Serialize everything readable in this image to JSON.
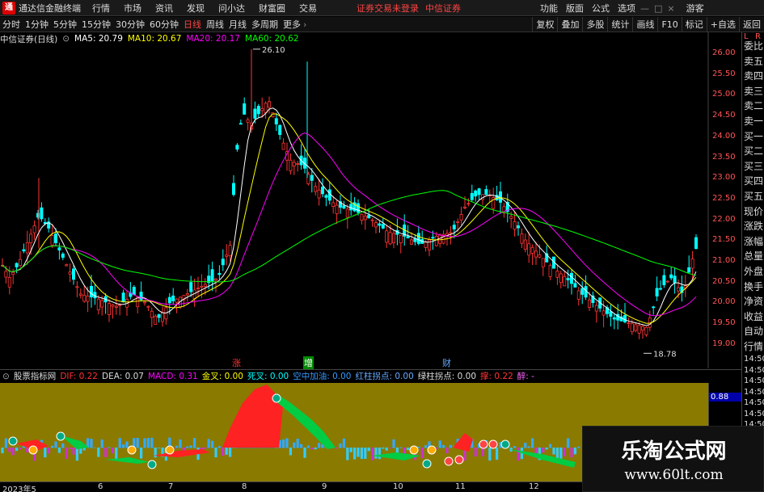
{
  "window": {
    "app_title": "通达信金融终端",
    "menu": [
      "行情",
      "市场",
      "资讯",
      "发现",
      "问小达",
      "财富圈",
      "交易"
    ],
    "notice_login": "证券交易未登录",
    "notice_broker": "中信证券",
    "right_menu": [
      "功能",
      "版面",
      "公式",
      "选项"
    ],
    "guest": "游客"
  },
  "toolbar": {
    "periods": [
      "分时",
      "1分钟",
      "5分钟",
      "15分钟",
      "30分钟",
      "60分钟",
      "日线",
      "周线",
      "月线",
      "多周期",
      "更多"
    ],
    "active_period": "日线",
    "right_buttons": [
      "复权",
      "叠加",
      "多股",
      "统计",
      "画线",
      "F10",
      "标记",
      "+自选",
      "返回"
    ]
  },
  "main_chart": {
    "security": "中信证券(日线)",
    "ma_labels": [
      {
        "label": "MA5: 20.79",
        "color": "#ffffff"
      },
      {
        "label": "MA10: 20.67",
        "color": "#ffff00"
      },
      {
        "label": "MA20: 20.17",
        "color": "#ff00ff"
      },
      {
        "label": "MA60: 20.62",
        "color": "#00ff00"
      }
    ],
    "high_label": "26.10",
    "low_label": "18.78",
    "price_ticks": [
      "26.00",
      "25.50",
      "25.00",
      "24.50",
      "24.00",
      "23.50",
      "23.00",
      "22.50",
      "22.00",
      "21.50",
      "21.00",
      "20.50",
      "20.00",
      "19.50",
      "19.00"
    ],
    "markers": [
      {
        "text": "涨",
        "color": "#ff3333"
      },
      {
        "text": "增",
        "color": "#00cc00"
      },
      {
        "text": "财",
        "color": "#66aaff"
      }
    ]
  },
  "sub_chart": {
    "indicator_name": "股票指标网",
    "items": [
      {
        "label": "DIF: 0.22",
        "color": "#ff3333"
      },
      {
        "label": "DEA: 0.07",
        "color": "#dddddd"
      },
      {
        "label": "MACD: 0.31",
        "color": "#ff00ff"
      },
      {
        "label": "金叉: 0.00",
        "color": "#ffff00"
      },
      {
        "label": "死叉: 0.00",
        "color": "#00ffff"
      },
      {
        "label": "空中加油: 0.00",
        "color": "#3399ff"
      },
      {
        "label": "红柱拐点: 0.00",
        "color": "#66aaff"
      },
      {
        "label": "绿柱拐点: 0.00",
        "color": "#dddddd"
      },
      {
        "label": "撑: 0.22",
        "color": "#ff3333"
      },
      {
        "label": "醉: -",
        "color": "#ff66ff"
      }
    ],
    "axis_value": "0.88"
  },
  "right_panel": {
    "letters": [
      "L",
      "R"
    ],
    "items": [
      "委比",
      "卖五",
      "卖四",
      "卖三",
      "卖二",
      "卖一",
      "买一",
      "买二",
      "买三",
      "买四",
      "买五",
      "现价",
      "涨跌",
      "涨幅",
      "总量",
      "外盘",
      "换手",
      "净资",
      "收益",
      "自动",
      "行情",
      "14:50",
      "14:50",
      "14:50",
      "14:50",
      "14:50",
      "14:50",
      "14:50",
      "14:50"
    ]
  },
  "date_axis": [
    "2023年5",
    "6",
    "7",
    "8",
    "9",
    "10",
    "11",
    "12"
  ],
  "watermark": {
    "title": "乐淘公式网",
    "url": "www.60lt.com"
  }
}
